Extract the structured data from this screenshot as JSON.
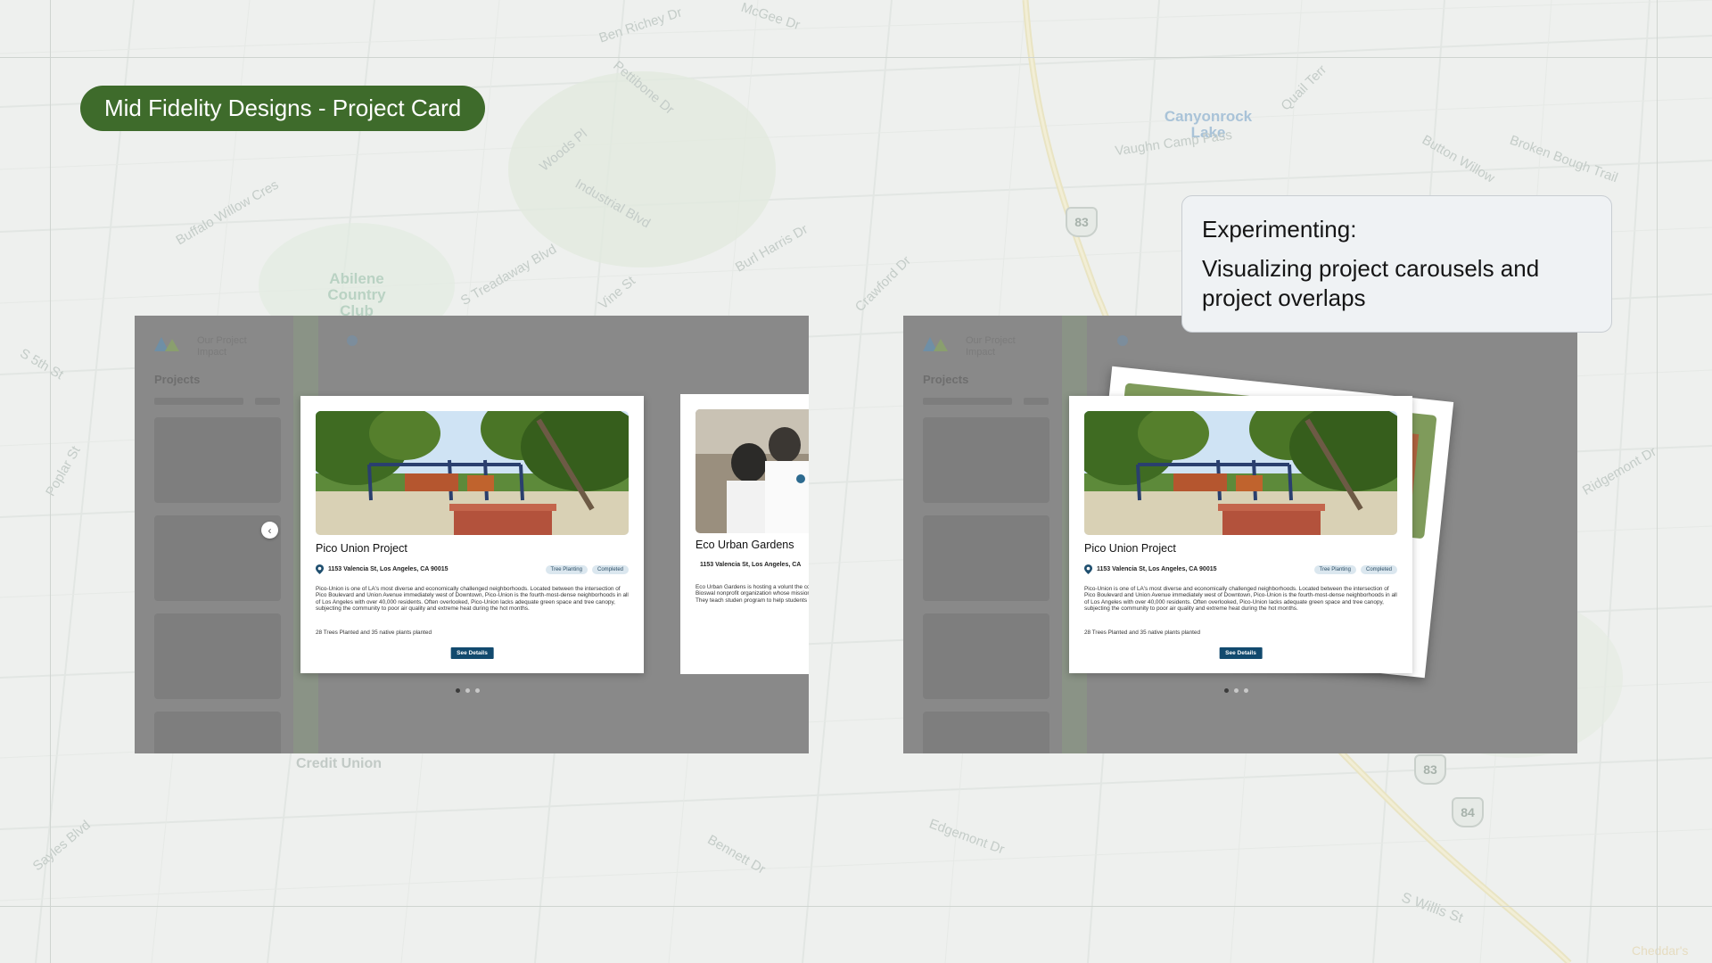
{
  "title": "Mid Fidelity Designs - Project Card",
  "note": {
    "heading": "Experimenting:",
    "body": "Visualizing project carousels and project overlaps"
  },
  "map_labels": {
    "street_a": "Ben Richey Dr",
    "street_b": "McGee Dr",
    "street_c": "Pettibone Dr",
    "street_d": "Woods Pl",
    "street_e": "Industrial Blvd",
    "street_f": "Buffalo Willow Cres",
    "street_g": "S Treadaway Blvd",
    "street_h": "Vine St",
    "street_i": "Burl Harris Dr",
    "street_j": "Crawford Dr",
    "park": "Abilene Country Club",
    "lake": "Canyonrock Lake",
    "street_k": "Vaughn Camp Pass",
    "street_l": "Quail Terr",
    "street_m": "Broken Bough Trail",
    "street_n": "Button Willow",
    "street_o": "Ridgemont Dr",
    "street_p": "Credit Union",
    "street_q": "Sayles Blvd",
    "street_r": "Bennett Dr",
    "street_s": "Edgemont Dr",
    "street_t": "S Willis St",
    "street_u": "Cheddar's",
    "street_v": "Poplar St",
    "street_w": "S 5th St"
  },
  "shields": [
    "83",
    "83",
    "84"
  ],
  "frame": {
    "app_name": "Our Project Impact",
    "projects_label": "Projects"
  },
  "cards": {
    "main": {
      "title": "Pico Union Project",
      "address": "1153 Valencia St, Los Angeles, CA 90015",
      "tags": [
        "Tree Planting",
        "Completed"
      ],
      "description": "Pico-Union is one of LA's most diverse and economically challenged neighborhoods. Located between the intersection of Pico Boulevard and Union Avenue immediately west of Downtown, Pico-Union is the fourth-most-dense neighborhoods in all of Los Angeles with over 40,000 residents. Often overlooked, Pico-Union lacks adequate green space and tree canopy, subjecting the community to poor air quality and extreme heat during the hot months.",
      "stat": "28 Trees Planted and 35 native plants planted",
      "button": "See Details"
    },
    "second": {
      "title": "Eco Urban Gardens",
      "address": "1153 Valencia St, Los Angeles, CA",
      "description": "Eco Urban Gardens is hosting a volunt the completion of a Vegetated Bioswal nonprofit organization whose mission i regenerative living. They teach studen program to help students feel connect"
    }
  },
  "carousel": {
    "pages": 3,
    "active": 0
  },
  "colors": {
    "pill": "#3e6b2b",
    "button": "#124a6e",
    "tag_bg": "#dbe7ef"
  }
}
